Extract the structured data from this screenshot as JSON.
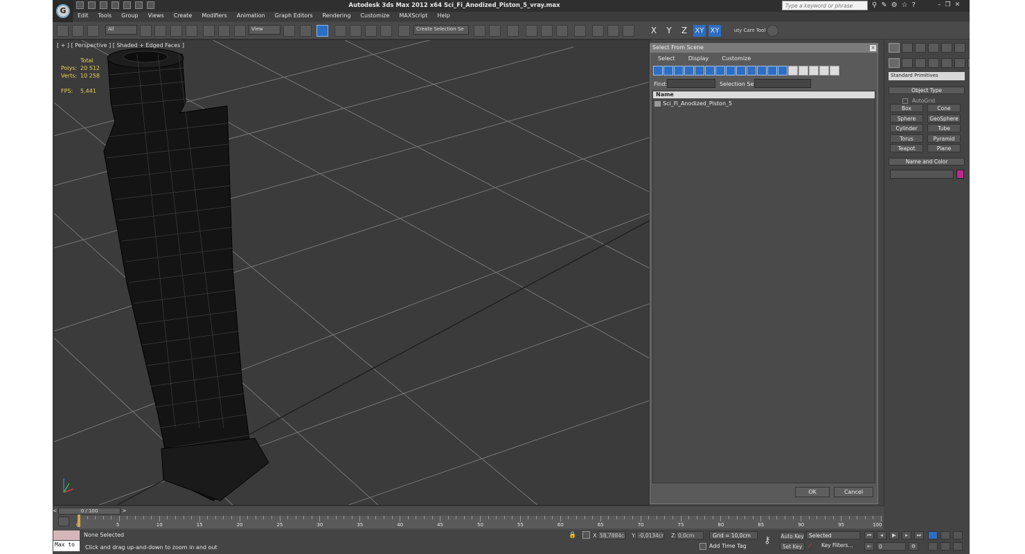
{
  "app": {
    "title": "Autodesk 3ds Max  2012 x64     Sci_Fi_Anodized_Piston_5_vray.max",
    "search_placeholder": "Type a keyword or phrase",
    "logo_letter": "G"
  },
  "menu": [
    "Edit",
    "Tools",
    "Group",
    "Views",
    "Create",
    "Modifiers",
    "Animation",
    "Graph Editors",
    "Rendering",
    "Customize",
    "MAXScript",
    "Help"
  ],
  "toolbar": {
    "filter": "All",
    "ref_coord": "View",
    "selection_set": "Create Selection Se",
    "axes": [
      "X",
      "Y",
      "Z",
      "XY",
      "XY"
    ],
    "cam_tool": "uty Cam Tool \\"
  },
  "viewport": {
    "label": "[ + ] [ Perspective ] [ Shaded + Edged Faces ]",
    "stats": {
      "total": "Total",
      "polys_label": "Polys:",
      "polys": "20 512",
      "verts_label": "Verts:",
      "verts": "10 258",
      "fps_label": "FPS:",
      "fps": "5,441"
    }
  },
  "dialog": {
    "title": "Select From Scene",
    "menu": [
      "Select",
      "Display",
      "Customize"
    ],
    "find_label": "Find:",
    "selection_set_label": "Selection Set:",
    "column_name": "Name",
    "items": [
      "Sci_Fi_Anodized_Piston_5"
    ],
    "ok": "OK",
    "cancel": "Cancel"
  },
  "command_panel": {
    "category": "Standard Primitives",
    "object_type": "Object Type",
    "autogrid": "AutoGrid",
    "buttons": [
      "Box",
      "Cone",
      "Sphere",
      "GeoSphere",
      "Cylinder",
      "Tube",
      "Torus",
      "Pyramid",
      "Teapot",
      "Plane"
    ],
    "name_and_color": "Name and Color",
    "color": "#c2288c"
  },
  "timeline": {
    "frame_display": "0 / 100",
    "prev": "<",
    "next": ">",
    "ticks": [
      "0",
      "5",
      "10",
      "15",
      "20",
      "25",
      "30",
      "35",
      "40",
      "45",
      "50",
      "55",
      "60",
      "65",
      "70",
      "75",
      "80",
      "85",
      "90",
      "95",
      "100"
    ]
  },
  "status": {
    "maxscript_label": "Max to",
    "selection": "None Selected",
    "prompt": "Click and drag up-and-down to zoom in and out",
    "x_label": "X:",
    "x": "58,7884cm",
    "y_label": "Y:",
    "y": "-0,0134cm",
    "z_label": "Z:",
    "z": "0,0cm",
    "grid": "Grid = 10,0cm",
    "add_time_tag": "Add Time Tag",
    "auto_key": "Auto Key",
    "set_key": "Set Key",
    "selected": "Selected",
    "key_filters": "Key Filters...",
    "frame": "0"
  }
}
